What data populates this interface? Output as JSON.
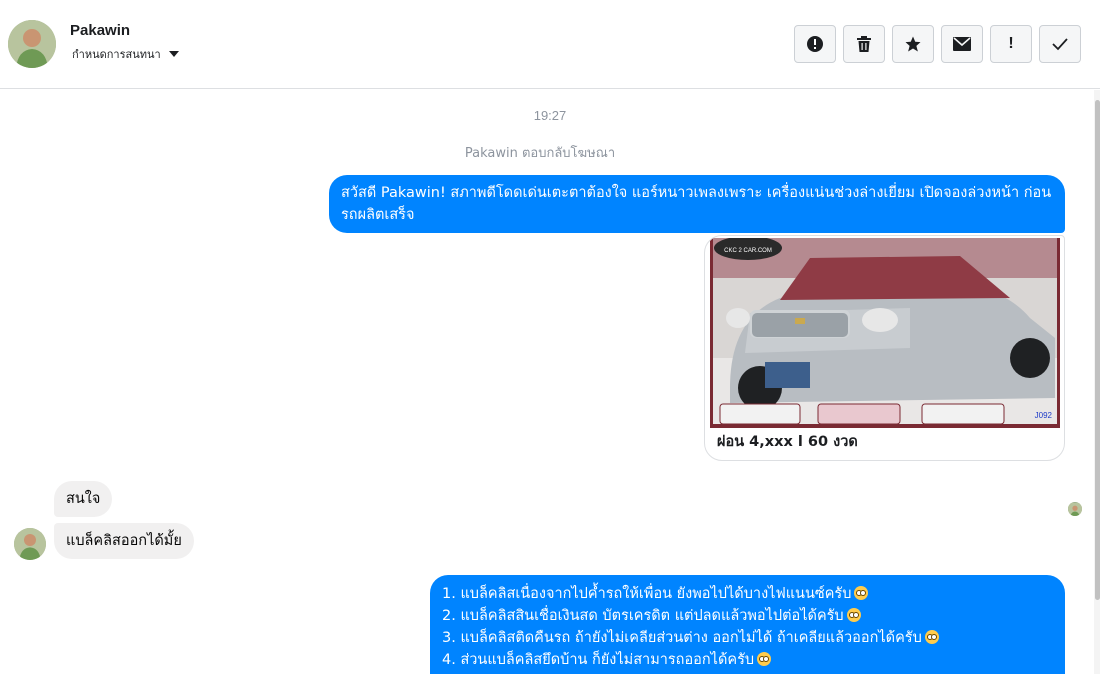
{
  "header": {
    "name": "Pakawin",
    "assign_label": "กำหนดการสนทนา",
    "actions": [
      "alert-circle-icon",
      "trash-icon",
      "star-icon",
      "mail-icon",
      "exclamation-icon",
      "check-icon"
    ]
  },
  "conversation": {
    "timestamp": "19:27",
    "system_note": "Pakawin ตอบกลับโฆษณา",
    "outgoing_1": "สวัสดี Pakawin! สภาพดีโดดเด่นเตะตาต้องใจ แอร์หนาวเพลงเพราะ เครื่องแน่นช่วงล่างเยี่ยม เปิดจองล่วงหน้า ก่อนรถผลิตเสร็จ",
    "card": {
      "title": "ผ่อน 4,xxx l 60 งวด",
      "watermark": "CKC 2 CAR.COM",
      "code": "J092"
    },
    "incoming": [
      "สนใจ",
      "แบล็คลิสออกได้มั้ย"
    ],
    "outgoing_2": [
      "1. แบล็คลิสเนื่องจากไปค้ำรถให้เพื่อน ยังพอไปได้บางไฟแนนซ์ครับ",
      "2. แบล็คลิสสินเชื่อเงินสด บัตรเครดิต แต่ปลดแล้วพอไปต่อได้ครับ",
      "3. แบล็คลิสติดคืนรถ ถ้ายังไม่เคลียส่วนต่าง ออกไม่ได้ ถ้าเคลียแล้วออกได้ครับ",
      "4. ส่วนแบล็คลิสยึดบ้าน ก็ยังไม่สามารถออกได้ครับ"
    ]
  },
  "colors": {
    "accent": "#0084ff",
    "incoming_bg": "#f1f0f0",
    "muted_text": "#8d949e"
  }
}
